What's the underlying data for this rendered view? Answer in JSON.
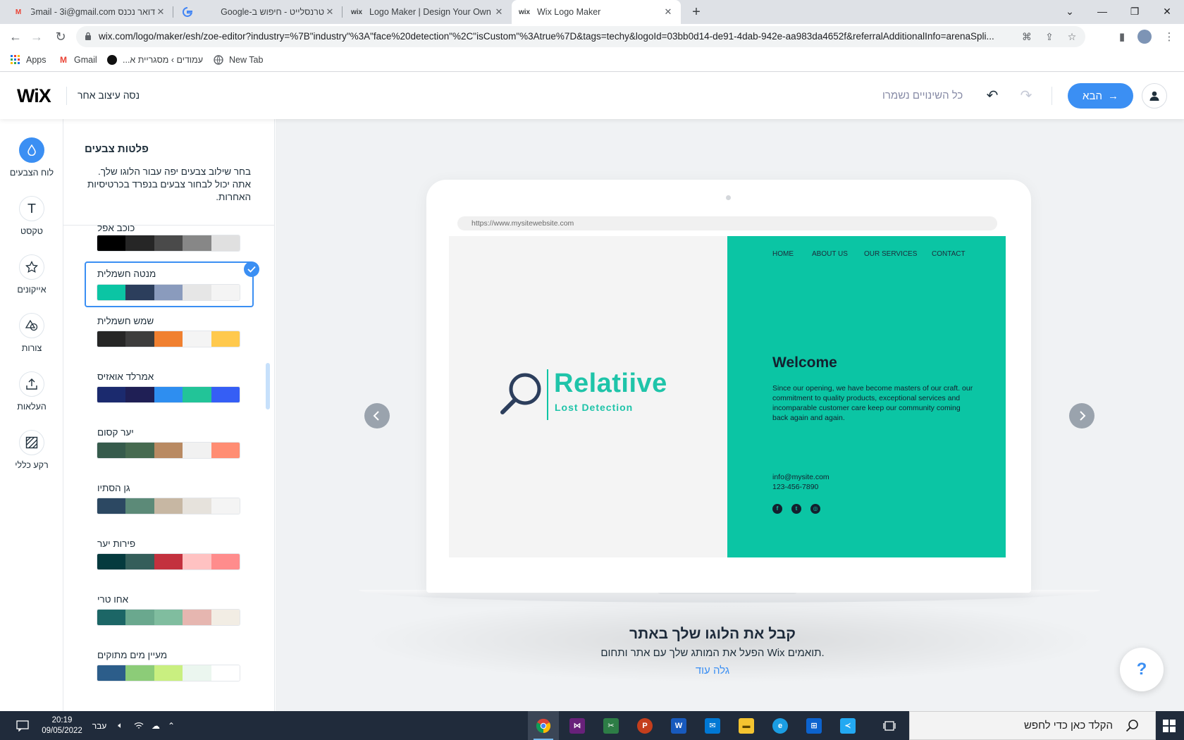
{
  "browser": {
    "tabs": [
      {
        "title": "דואר נכנס Gmail - 3i@gmail.com",
        "icon": "gmail-icon"
      },
      {
        "title": "טרנסלייט - חיפוש ב-Google",
        "icon": "google-icon"
      },
      {
        "title": "Logo Maker | Design Your Own B",
        "icon": "wix-icon"
      },
      {
        "title": "Wix Logo Maker",
        "icon": "wix-icon",
        "active": true
      }
    ],
    "url": "wix.com/logo/maker/esh/zoe-editor?industry=%7B\"industry\"%3A\"face%20detection\"%2C\"isCustom\"%3Atrue%7D&tags=techy&logoId=03bb0d14-de91-4dab-942e-aa983da4652f&referralAdditionalInfo=arenaSpli...",
    "bookmarks": [
      {
        "label": "Apps",
        "icon": "apps-grid-icon"
      },
      {
        "label": "Gmail",
        "icon": "gmail-icon"
      },
      {
        "label": "עמודים › מסגריית א...",
        "icon": "page-icon"
      },
      {
        "label": "New Tab",
        "icon": "globe-icon"
      }
    ]
  },
  "header": {
    "logo": "WiX",
    "try_other": "נסה עיצוב אחר",
    "saved_status": "כל השינויים נשמרו",
    "next_label": "הבא"
  },
  "rail": [
    {
      "label": "לוח הצבעים",
      "icon": "color-drop-icon",
      "selected": true
    },
    {
      "label": "טקסט",
      "icon": "text-icon"
    },
    {
      "label": "אייקונים",
      "icon": "star-icon"
    },
    {
      "label": "צורות",
      "icon": "shapes-icon"
    },
    {
      "label": "העלאות",
      "icon": "upload-icon"
    },
    {
      "label": "רקע כללי",
      "icon": "background-pattern-icon"
    }
  ],
  "panel": {
    "title": "פלטות צבעים",
    "description": "בחר שילוב צבעים יפה עבור הלוגו שלך. אתה יכול לבחור צבעים בנפרד בכרטיסיות האחרות.",
    "palettes": [
      {
        "name": "כוכב אפל",
        "colors": [
          "#000000",
          "#262626",
          "#4a4a4a",
          "#878787",
          "#e0e0e0"
        ]
      },
      {
        "name": "מנטה חשמלית",
        "colors": [
          "#0bc5a4",
          "#2c3e5c",
          "#8a9bbd",
          "#e6e6e6",
          "#f4f4f4"
        ],
        "selected": true
      },
      {
        "name": "שמש חשמלית",
        "colors": [
          "#262626",
          "#3d3d3d",
          "#f08030",
          "#f4f4f4",
          "#ffc94d"
        ]
      },
      {
        "name": "אמרלד אואזיס",
        "colors": [
          "#1b2a6e",
          "#1f1f55",
          "#2e8ef0",
          "#22c498",
          "#355ef5"
        ]
      },
      {
        "name": "יער קסום",
        "colors": [
          "#365b4c",
          "#466a50",
          "#b98a62",
          "#f1f1f1",
          "#ff8d73"
        ]
      },
      {
        "name": "גן הסתיו",
        "colors": [
          "#2c4862",
          "#5c8a78",
          "#c7b7a3",
          "#e6e2dc",
          "#f4f4f4"
        ]
      },
      {
        "name": "פירות יער",
        "colors": [
          "#053a3e",
          "#345e5a",
          "#c3313e",
          "#ffc2c2",
          "#ff8c8c"
        ]
      },
      {
        "name": "אחו טרי",
        "colors": [
          "#1c6666",
          "#6aa88e",
          "#80bd9f",
          "#e6b6b0",
          "#f2ede4"
        ]
      },
      {
        "name": "מעיין מים מתוקים",
        "colors": [
          "#2c5d8a",
          "#8ccc78",
          "#c9ef80",
          "#ebf6ef",
          "#ffffff"
        ]
      }
    ]
  },
  "preview": {
    "mock_url": "https://www.mysitewebsite.com",
    "nav": [
      "HOME",
      "ABOUT US",
      "OUR SERVICES",
      "CONTACT"
    ],
    "welcome": "Welcome",
    "body": "Since our opening, we have become masters of our craft. our commitment to quality products, exceptional services and incomparable customer care keep our community coming back again and again.",
    "email": "info@mysite.com",
    "phone": "123-456-7890",
    "logo_name": "Relatiive",
    "logo_tagline": "Lost Detection",
    "brand_colors": {
      "mint": "#0bc5a4",
      "navy": "#2c3e5c"
    }
  },
  "promo": {
    "title": "קבל את הלוגו שלך באתר",
    "subtitle": ".תואמים Wix הפעל את המותג שלך עם אתר ותחום",
    "link": "גלה עוד"
  },
  "help_label": "?",
  "taskbar": {
    "search_placeholder": "הקלד כאן כדי לחפש",
    "time": "20:19",
    "date": "09/05/2022",
    "lang": "עבר",
    "apps": [
      "chrome-icon",
      "visual-studio-icon",
      "excel-like-icon",
      "powerpoint-icon",
      "word-icon",
      "mail-icon",
      "file-explorer-icon",
      "edge-icon",
      "store-icon",
      "vscode-icon",
      "task-view-icon"
    ]
  }
}
